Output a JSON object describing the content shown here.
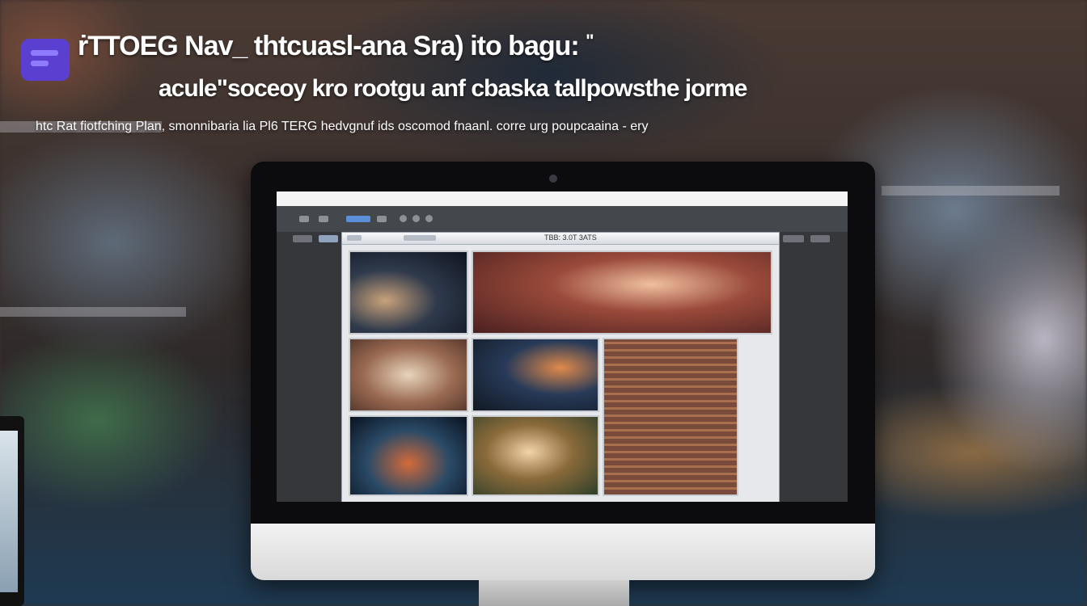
{
  "headline": {
    "line1": "ṙTTOEG Nav_ thtcuasl-ana Sra) ito bagu:",
    "line1_mark": "\"",
    "line2": "acule\"soceoy kro rootgu anf cbaska tallpowsthe jorme",
    "line3": "htc Rat fiotfching Plan, smonnibaria lia Pl6 TERG hedvgnuf ids oscomod fnaanl. corre urg poupcaaina - ery"
  },
  "screen": {
    "window_title": "TBB: 3.0T 3ATS"
  },
  "colors": {
    "logo": "#5a3fd0",
    "screen_bg": "#3d3f44",
    "accent": "#5c8fd8"
  },
  "icons": {
    "logo": "chat-window-icon",
    "camera": "webcam-icon"
  }
}
